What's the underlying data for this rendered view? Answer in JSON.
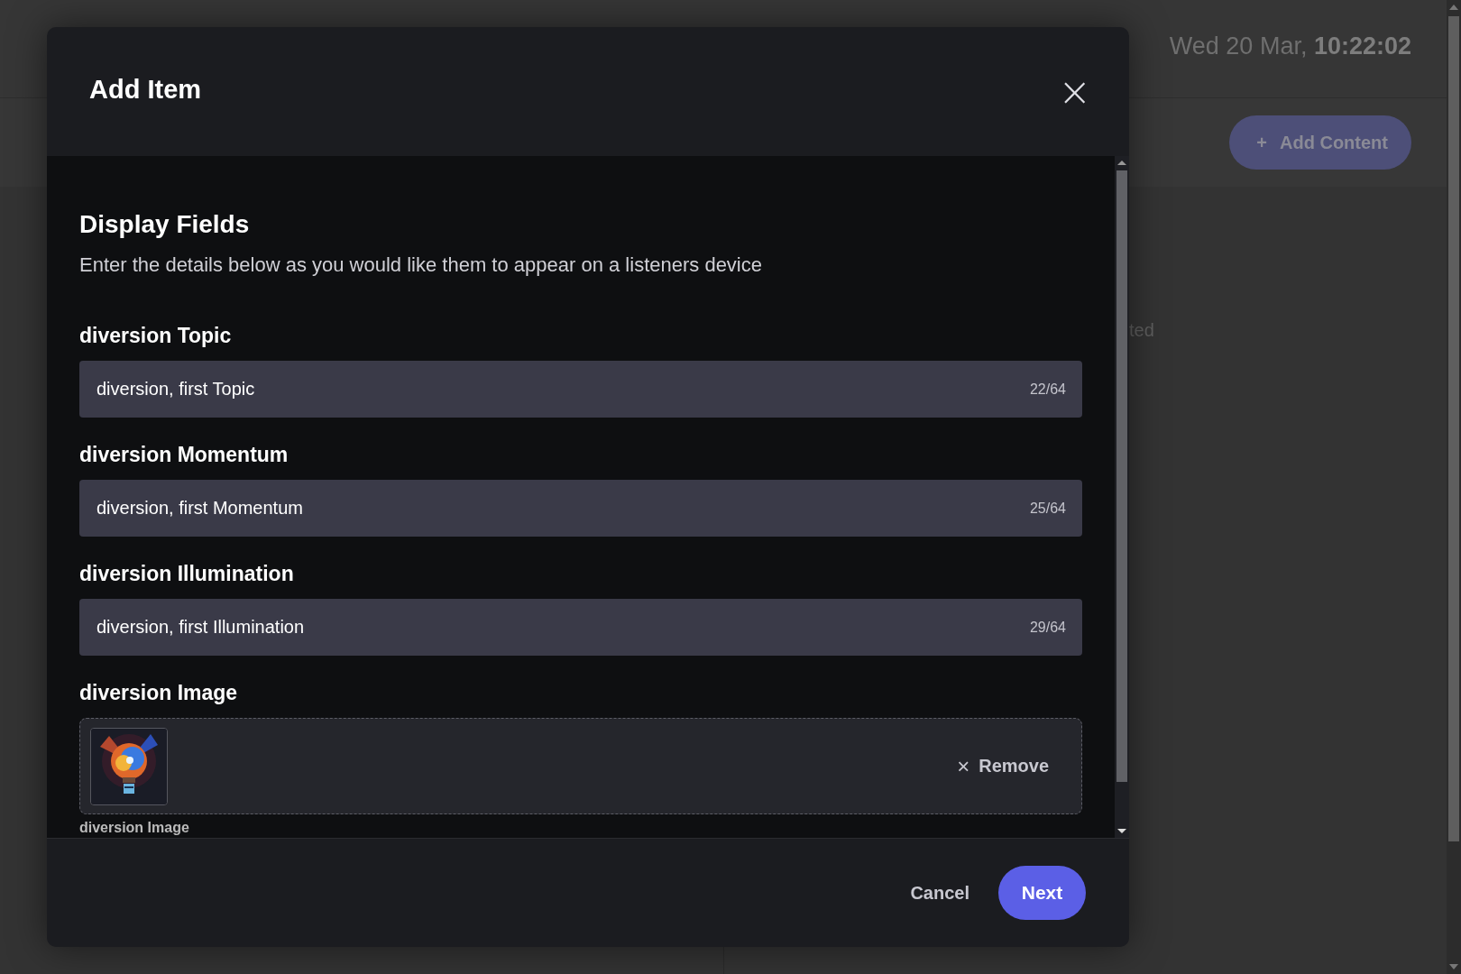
{
  "background": {
    "datetime": {
      "date": "Wed 20 Mar,",
      "time": "10:22:02"
    },
    "add_button": {
      "icon": "+",
      "label": "Add Content"
    },
    "partial_text": "ted"
  },
  "dialog": {
    "title": "Add Item",
    "close_icon": "×",
    "section": {
      "heading": "Display Fields",
      "description": "Enter the details below as you would like them to appear on a listeners device"
    },
    "fields": [
      {
        "kind": "text",
        "label": "diversion Topic",
        "value": "diversion, first Topic",
        "counter": "22/64"
      },
      {
        "kind": "text",
        "label": "diversion Momentum",
        "value": "diversion, first Momentum",
        "counter": "25/64"
      },
      {
        "kind": "text",
        "label": "diversion Illumination",
        "value": "diversion, first Illumination",
        "counter": "29/64"
      },
      {
        "label": "diversion Image",
        "remove_icon": "×",
        "remove_label": "Remove",
        "caption": "diversion Image"
      }
    ],
    "buttons": {
      "cancel": "Cancel",
      "next": "Next"
    }
  }
}
